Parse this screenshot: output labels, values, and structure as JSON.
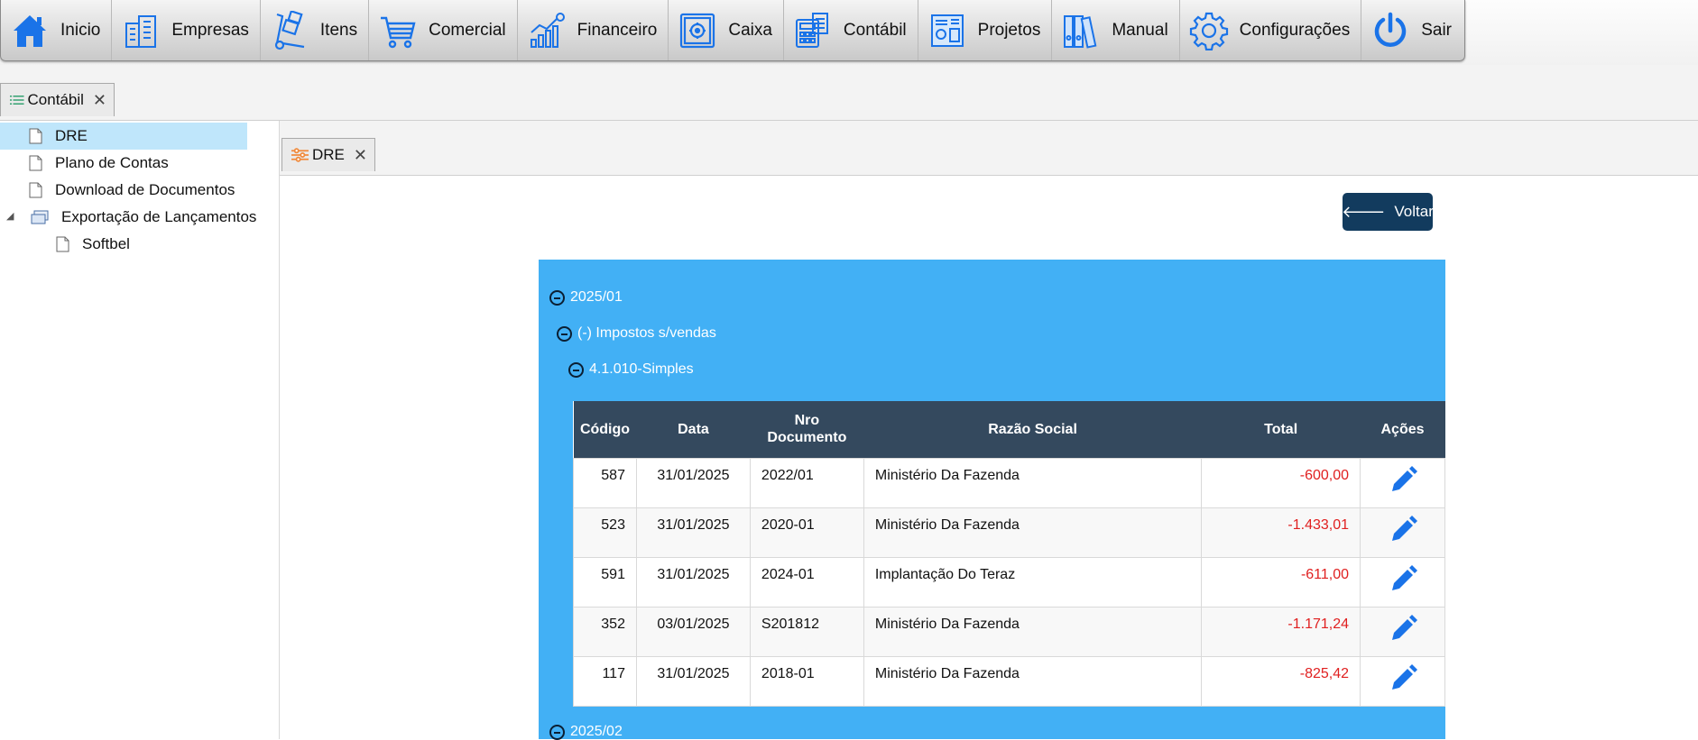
{
  "menu": {
    "items": [
      {
        "label": "Inicio",
        "icon": "home-icon"
      },
      {
        "label": "Empresas",
        "icon": "buildings-icon"
      },
      {
        "label": "Itens",
        "icon": "hand-truck-icon"
      },
      {
        "label": "Comercial",
        "icon": "shopping-cart-icon"
      },
      {
        "label": "Financeiro",
        "icon": "growth-chart-icon"
      },
      {
        "label": "Caixa",
        "icon": "safe-icon"
      },
      {
        "label": "Contábil",
        "icon": "calculator-icon"
      },
      {
        "label": "Projetos",
        "icon": "blueprint-icon"
      },
      {
        "label": "Manual",
        "icon": "binders-icon"
      },
      {
        "label": "Configurações",
        "icon": "gear-icon"
      },
      {
        "label": "Sair",
        "icon": "power-icon"
      }
    ]
  },
  "outer_tab": {
    "label": "Contábil",
    "close": "✕"
  },
  "sidebar": {
    "items": [
      {
        "label": "DRE"
      },
      {
        "label": "Plano de Contas"
      },
      {
        "label": "Download de Documentos"
      },
      {
        "label": "Exportação de Lançamentos"
      },
      {
        "label": "Softbel"
      }
    ]
  },
  "inner_tab": {
    "label": "DRE",
    "close": "✕"
  },
  "voltar": {
    "arrow": "🡐",
    "label": "Voltar"
  },
  "dre": {
    "groups": [
      {
        "label": "2025/01"
      },
      {
        "label": "(-) Impostos s/vendas"
      },
      {
        "label": "4.1.010-Simples"
      },
      {
        "label": "2025/02"
      }
    ],
    "columns": [
      "Código",
      "Data",
      "Nro Documento",
      "Razão Social",
      "Total",
      "Ações"
    ],
    "rows": [
      {
        "codigo": "587",
        "data": "31/01/2025",
        "nro": "2022/01",
        "razao": "Ministério Da Fazenda",
        "total": "-600,00"
      },
      {
        "codigo": "523",
        "data": "31/01/2025",
        "nro": "2020-01",
        "razao": "Ministério Da Fazenda",
        "total": "-1.433,01"
      },
      {
        "codigo": "591",
        "data": "31/01/2025",
        "nro": "2024-01",
        "razao": "Implantação Do Teraz",
        "total": "-611,00"
      },
      {
        "codigo": "352",
        "data": "03/01/2025",
        "nro": "S201812",
        "razao": "Ministério Da Fazenda",
        "total": "-1.171,24"
      },
      {
        "codigo": "117",
        "data": "31/01/2025",
        "nro": "2018-01",
        "razao": "Ministério Da Fazenda",
        "total": "-825,42"
      }
    ]
  },
  "colors": {
    "accent_blue": "#42b0f5",
    "table_header": "#34495e",
    "voltar_button": "#123b5e",
    "negative_total": "#e02020",
    "selected_tree_item": "#bfe6fb",
    "icon_blue": "#1a73e8"
  }
}
